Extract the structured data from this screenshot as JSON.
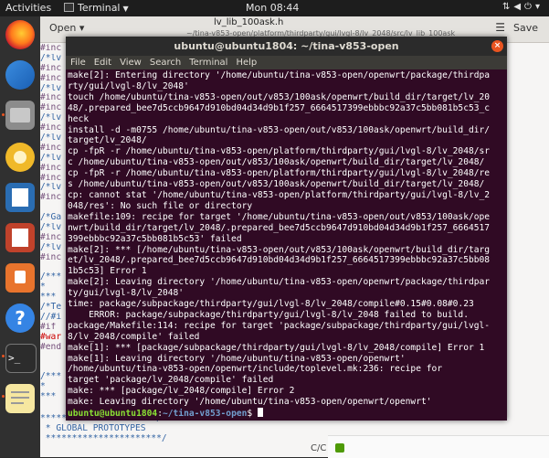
{
  "topbar": {
    "activities": "Activities",
    "app_name": "Terminal",
    "clock": "Mon 08:44"
  },
  "dock": {
    "items": [
      "firefox",
      "thunderbird",
      "files",
      "rhythmbox",
      "libreoffice-writer",
      "libreoffice-impress",
      "software",
      "help",
      "terminal",
      "text-editor"
    ]
  },
  "editor": {
    "open_label": "Open",
    "filename": "lv_lib_100ask.h",
    "filepath": "~/tina-v853-open/platform/thirdparty/gui/lvgl-8/lv_2048/src/lv_lib_100ask",
    "save_label": "Save",
    "left_lines": [
      "#inc",
      "/*lv",
      "#inc",
      "#inc",
      "/*lv",
      "#inc",
      "#inc",
      "/*lv",
      "#inc",
      "/*lv",
      "#inc",
      "/*lv",
      "#inc",
      "#inc",
      "/*lv",
      "#inc",
      "",
      "/*Ga",
      "/*lv",
      "#inc",
      "/*lv",
      "#inc",
      "",
      "/***",
      " *",
      " ***",
      "/*Te",
      "//#i",
      "#if",
      "#war",
      "#end",
      "",
      "",
      "/***",
      " *",
      " ***"
    ],
    "bottom_lines": [
      "**********************/",
      " * GLOBAL PROTOTYPES",
      " **********************/"
    ],
    "status_text": "C/C"
  },
  "terminal": {
    "title": "ubuntu@ubuntu1804: ~/tina-v853-open",
    "menu": [
      "File",
      "Edit",
      "View",
      "Search",
      "Terminal",
      "Help"
    ],
    "lines": [
      "make[2]: Entering directory '/home/ubuntu/tina-v853-open/openwrt/package/thirdpa",
      "rty/gui/lvgl-8/lv_2048'",
      "touch /home/ubuntu/tina-v853-open/out/v853/100ask/openwrt/build_dir/target/lv_20",
      "48/.prepared_bee7d5ccb9647d910bd04d34d9b1f257_6664517399ebbbc92a37c5bb081b5c53_c",
      "heck",
      "install -d -m0755 /home/ubuntu/tina-v853-open/out/v853/100ask/openwrt/build_dir/",
      "target/lv_2048/",
      "cp -fpR -r /home/ubuntu/tina-v853-open/platform/thirdparty/gui/lvgl-8/lv_2048/sr",
      "c /home/ubuntu/tina-v853-open/out/v853/100ask/openwrt/build_dir/target/lv_2048/",
      "cp -fpR -r /home/ubuntu/tina-v853-open/platform/thirdparty/gui/lvgl-8/lv_2048/re",
      "s /home/ubuntu/tina-v853-open/out/v853/100ask/openwrt/build_dir/target/lv_2048/",
      "cp: cannot stat '/home/ubuntu/tina-v853-open/platform/thirdparty/gui/lvgl-8/lv_2",
      "048/res': No such file or directory",
      "makefile:109: recipe for target '/home/ubuntu/tina-v853-open/out/v853/100ask/ope",
      "nwrt/build_dir/target/lv_2048/.prepared_bee7d5ccb9647d910bd04d34d9b1f257_6664517",
      "399ebbbc92a37c5bb081b5c53' failed",
      "make[2]: *** [/home/ubuntu/tina-v853-open/out/v853/100ask/openwrt/build_dir/targ",
      "et/lv_2048/.prepared_bee7d5ccb9647d910bd04d34d9b1f257_6664517399ebbbc92a37c5bb08",
      "1b5c53] Error 1",
      "make[2]: Leaving directory '/home/ubuntu/tina-v853-open/openwrt/package/thirdpar",
      "ty/gui/lvgl-8/lv_2048'",
      "time: package/subpackage/thirdparty/gui/lvgl-8/lv_2048/compile#0.15#0.08#0.23",
      "    ERROR: package/subpackage/thirdparty/gui/lvgl-8/lv_2048 failed to build.",
      "package/Makefile:114: recipe for target 'package/subpackage/thirdparty/gui/lvgl-",
      "8/lv_2048/compile' failed",
      "make[1]: *** [package/subpackage/thirdparty/gui/lvgl-8/lv_2048/compile] Error 1",
      "make[1]: Leaving directory '/home/ubuntu/tina-v853-open/openwrt'",
      "/home/ubuntu/tina-v853-open/openwrt/include/toplevel.mk:236: recipe for",
      "target 'package/lv_2048/compile' failed",
      "make: *** [package/lv_2048/compile] Error 2",
      "make: Leaving directory '/home/ubuntu/tina-v853-open/openwrt/openwrt'"
    ],
    "prompt_user": "ubuntu@ubuntu1804",
    "prompt_sep": ":",
    "prompt_path": "~/tina-v853-open",
    "prompt_symbol": "$ "
  }
}
